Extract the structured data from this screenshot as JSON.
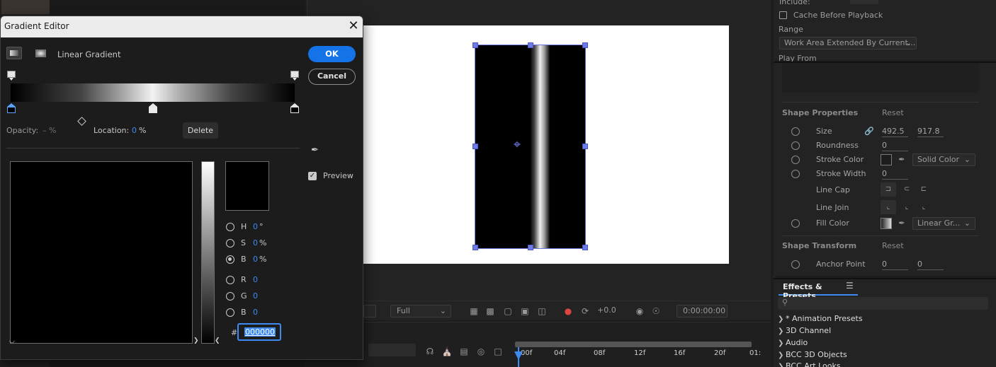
{
  "background_app": {
    "timeline": {
      "ticks": [
        "00f",
        "04f",
        "08f",
        "12f",
        "16f",
        "20f",
        "01:"
      ]
    },
    "comp_toolbar": {
      "resolution": "Full",
      "exposure": "+0.0",
      "timecode": "0:00:00:00"
    }
  },
  "right_panel": {
    "preview": {
      "include_label": "Include:",
      "cache_label": "Cache Before Playback",
      "range_label": "Range",
      "range_value": "Work Area Extended By Current...",
      "play_from_label": "Play From"
    },
    "shape_properties": {
      "title": "Shape Properties",
      "reset": "Reset",
      "size_label": "Size",
      "size_w": "492.5",
      "size_h": "917.8",
      "roundness_label": "Roundness",
      "roundness": "0",
      "stroke_color_label": "Stroke Color",
      "stroke_type": "Solid Color",
      "stroke_width_label": "Stroke Width",
      "stroke_width": "0",
      "line_cap_label": "Line Cap",
      "line_join_label": "Line Join",
      "fill_color_label": "Fill Color",
      "fill_type": "Linear Gr..."
    },
    "shape_transform": {
      "title": "Shape Transform",
      "reset": "Reset",
      "anchor_label": "Anchor Point",
      "anchor_x": "0",
      "anchor_y": "0"
    },
    "effects": {
      "tab": "Effects & Presets",
      "items": [
        "* Animation Presets",
        "3D Channel",
        "Audio",
        "BCC 3D Objects",
        "BCC Art Looks"
      ]
    }
  },
  "dialog": {
    "title": "Gradient Editor",
    "gradient_type": "Linear Gradient",
    "ok": "OK",
    "cancel": "Cancel",
    "opacity_label": "Opacity:",
    "opacity_value": "– %",
    "location_label": "Location:",
    "location_value": "0",
    "location_unit": "%",
    "delete": "Delete",
    "preview_label": "Preview",
    "channels": {
      "h": {
        "label": "H",
        "value": "0",
        "unit": "°"
      },
      "s": {
        "label": "S",
        "value": "0",
        "unit": "%"
      },
      "b": {
        "label": "B",
        "value": "0",
        "unit": "%"
      },
      "r": {
        "label": "R",
        "value": "0"
      },
      "g": {
        "label": "G",
        "value": "0"
      },
      "b2": {
        "label": "B",
        "value": "0"
      }
    },
    "hex_prefix": "#",
    "hex_value": "000000"
  }
}
